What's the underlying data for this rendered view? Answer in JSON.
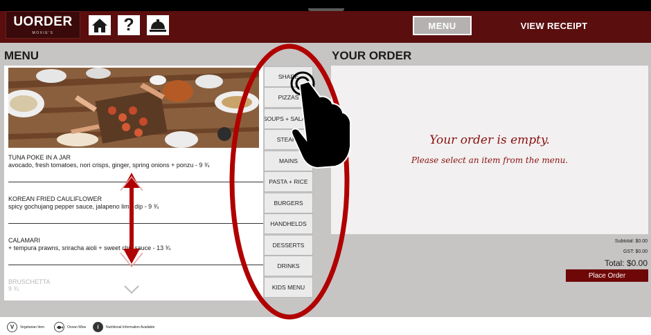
{
  "app": {
    "logo": "UORDER",
    "logo_sub": "MOXIE'S"
  },
  "header": {
    "home_icon": "home-icon",
    "help_icon": "question-icon",
    "service_icon": "service-bell-icon",
    "help_glyph": "?",
    "menu_label": "MENU",
    "receipt_label": "VIEW RECEIPT"
  },
  "menu": {
    "title": "MENU",
    "items": [
      {
        "name": "TUNA POKE IN A JAR",
        "desc": "avocado, fresh tomatoes, nori crisps, ginger, spring onions + ponzu - 9 ¾"
      },
      {
        "name": "KOREAN FRIED CAULIFLOWER",
        "desc": "spicy gochujang pepper sauce, jalapeno lime dip - 9 ¾"
      },
      {
        "name": "CALAMARI",
        "desc": "+ tempura prawns, sriracha aioli + sweet chili sauce - 13 ¾"
      },
      {
        "name": "BRUSCHETTA",
        "desc": "9 ¾"
      }
    ]
  },
  "categories": [
    "SHARE",
    "PIZZAS",
    "SOUPS + SALADS",
    "STEAKS",
    "MAINS",
    "PASTA + RICE",
    "BURGERS",
    "HANDHELDS",
    "DESSERTS",
    "DRINKS",
    "KIDS MENU"
  ],
  "order": {
    "title": "YOUR ORDER",
    "empty_title": "Your order is empty.",
    "empty_sub": "Please select an item from the menu.",
    "subtotal": "Subtotal: $0.00",
    "gst": "GST: $0.00",
    "total": "Total: $0.00",
    "place_label": "Place Order"
  },
  "legend": [
    {
      "glyph": "V",
      "label": "Vegetarian Item"
    },
    {
      "glyph": "",
      "label": "Ocean Wise"
    },
    {
      "glyph": "i",
      "label": "Nutritional Information Available"
    }
  ],
  "colors": {
    "brand": "#5a0e0e",
    "accent": "#8a1010",
    "button": "#6e0707",
    "annotation": "#b00000"
  }
}
